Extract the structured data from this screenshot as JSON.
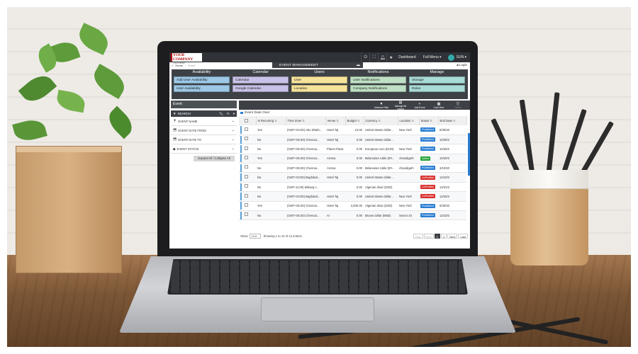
{
  "app": {
    "company": "YOUR COMPANY",
    "company_tag": "LOGO HERE",
    "topbar": {
      "dashboard": "Dashboard",
      "full_menu": "Full Menu ▾",
      "user": "SUN ▾"
    },
    "breadcrumb": {
      "home": "Home",
      "sep": "/",
      "current": "Event"
    },
    "module_title": "EVENT MANAGEMENT",
    "login": "Login"
  },
  "menu": {
    "columns": [
      {
        "title": "Availability",
        "items": [
          {
            "label": "Add User Availability",
            "color": "#9cc8e6"
          },
          {
            "label": "User Availability",
            "color": "#9cc8e6"
          }
        ]
      },
      {
        "title": "Calendar",
        "items": [
          {
            "label": "Calendar",
            "color": "#c9c2e8"
          },
          {
            "label": "Google Calendar",
            "color": "#c9c2e8"
          }
        ]
      },
      {
        "title": "Users",
        "items": [
          {
            "label": "User",
            "color": "#f6e39a"
          },
          {
            "label": "Location",
            "color": "#f6e39a"
          }
        ]
      },
      {
        "title": "Notifications",
        "items": [
          {
            "label": "User Notifications",
            "color": "#bfe0c4"
          },
          {
            "label": "Company Notifications",
            "color": "#bfe0c4"
          }
        ]
      },
      {
        "title": "Manage",
        "items": [
          {
            "label": "Storage",
            "color": "#a9dbd6"
          },
          {
            "label": "Roles",
            "color": "#a9dbd6"
          }
        ]
      }
    ]
  },
  "filters": {
    "title": "Event",
    "search_label": "SEARCH",
    "fields": [
      "EVENT NAME",
      "EVENT DATE FROM",
      "EVENT DATE TO",
      "EVENT STATUS"
    ],
    "expand_collapse": "Expand All / Collapse All"
  },
  "toolbar": [
    {
      "icon": "filter-icon",
      "label": "Advance Filter"
    },
    {
      "icon": "layout-icon",
      "label": "Manage list Layout"
    },
    {
      "icon": "plus-icon",
      "label": "Add Event"
    },
    {
      "icon": "card-icon",
      "label": "Card View"
    },
    {
      "icon": "trash-icon",
      "label": "Delete"
    }
  ],
  "group_label": "Event Date Over",
  "table": {
    "headers": [
      "Is Recurring",
      "Time Zone",
      "Venue",
      "Budget",
      "Currency",
      "Location",
      "Status",
      "End Date"
    ],
    "rows": [
      [
        "Yes",
        "(GMT+04:00) Abu Dhabi...",
        "Hotel Taj",
        "10.00",
        "United States dollar...",
        "New York",
        "Published",
        "6/30/20"
      ],
      [
        "No",
        "(GMT+05:30) Chennai...",
        "Hotel Taj",
        "0.00",
        "United States dollar...",
        "",
        "Published",
        "10/30/2"
      ],
      [
        "No",
        "(GMT+05:30) Chennai...",
        "Planet Plaza",
        "0.00",
        "European euro (EUR)",
        "New York",
        "Published",
        "10/25/2"
      ],
      [
        "Yes",
        "(GMT+05:30) Chennai...",
        "Aroma",
        "0.00",
        "Belarusian ruble (BY...",
        "chandigarh",
        "Active",
        "10/20/2"
      ],
      [
        "No",
        "(GMT+05:30) Chennai...",
        "Aroma",
        "0.00",
        "Belarusian ruble (BY...",
        "chandigarh",
        "Published",
        "3/10/20"
      ],
      [
        "No",
        "(GMT+03:00) Baghdad...",
        "Hotel Taj",
        "0.00",
        "United States dollar...",
        "",
        "UnPublish",
        "12/10/2"
      ],
      [
        "No",
        "(GMT-11:00) Midway I...",
        "",
        "0.00",
        "Algerian dinar (DZD)",
        "",
        "UnPublish",
        "12/31/2"
      ],
      [
        "No",
        "(GMT+03:00) Baghdad...",
        "Hotel Taj",
        "0.00",
        "United States dollar...",
        "New York",
        "UnPublish",
        "12/25/2"
      ],
      [
        "Yes",
        "(GMT+05:30) Chennai...",
        "Hotel Taj",
        "2,000.00",
        "Algerian dinar (DZD)",
        "New York",
        "Published",
        "6/30/20"
      ],
      [
        "No",
        "(GMT+05:30) Chennai...",
        "AI",
        "0.00",
        "Brunei dollar (BND)",
        "Sector 34",
        "Published",
        "12/10/2"
      ]
    ]
  },
  "pager": {
    "show": "Show",
    "page_size": "10",
    "summary": "Showing 1 to 10 of 14 entries",
    "buttons": [
      "First",
      "Prev",
      "1",
      "2",
      "Next",
      "Last"
    ],
    "active": "1"
  }
}
